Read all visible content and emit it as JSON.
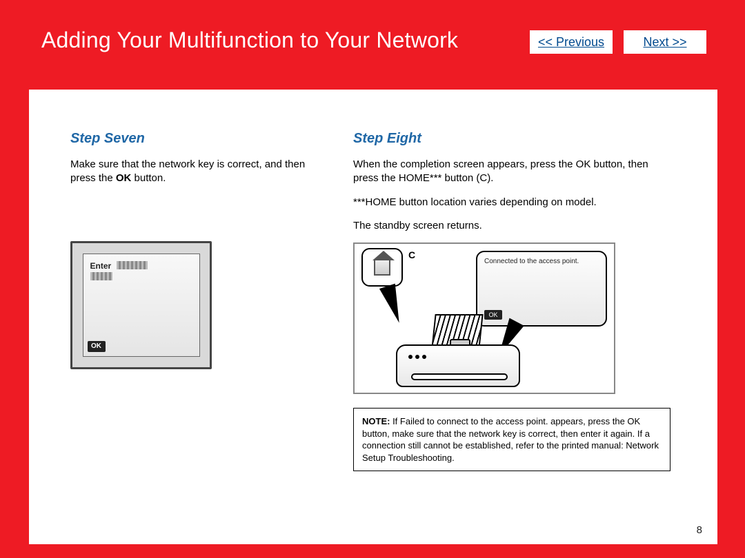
{
  "header": {
    "title": "Adding Your Multifunction to Your Network",
    "prev_label": "<< Previous",
    "next_label": "Next >>"
  },
  "left": {
    "step_title": "Step Seven",
    "para_a": "Make sure that the network key is correct, and then press the ",
    "para_b_bold": "OK",
    "para_c": " button.",
    "lcd_enter": "Enter",
    "lcd_ok": "OK"
  },
  "right": {
    "step_title": "Step Eight",
    "para1": "When the completion screen appears, press the OK button, then press the HOME*** button (C).",
    "para2": "***HOME button location varies depending on model.",
    "para3": "The standby screen returns.",
    "bubble_c": "C",
    "bubble_msg": "Connected to the access point.",
    "bubble_ok": "OK",
    "note_bold": "NOTE:",
    "note_text": "  If Failed to connect to the access point. appears, press the OK button, make sure that the network key is correct, then enter it again. If a connection still cannot be established, refer to the printed manual: Network Setup Troubleshooting."
  },
  "page_number": "8"
}
